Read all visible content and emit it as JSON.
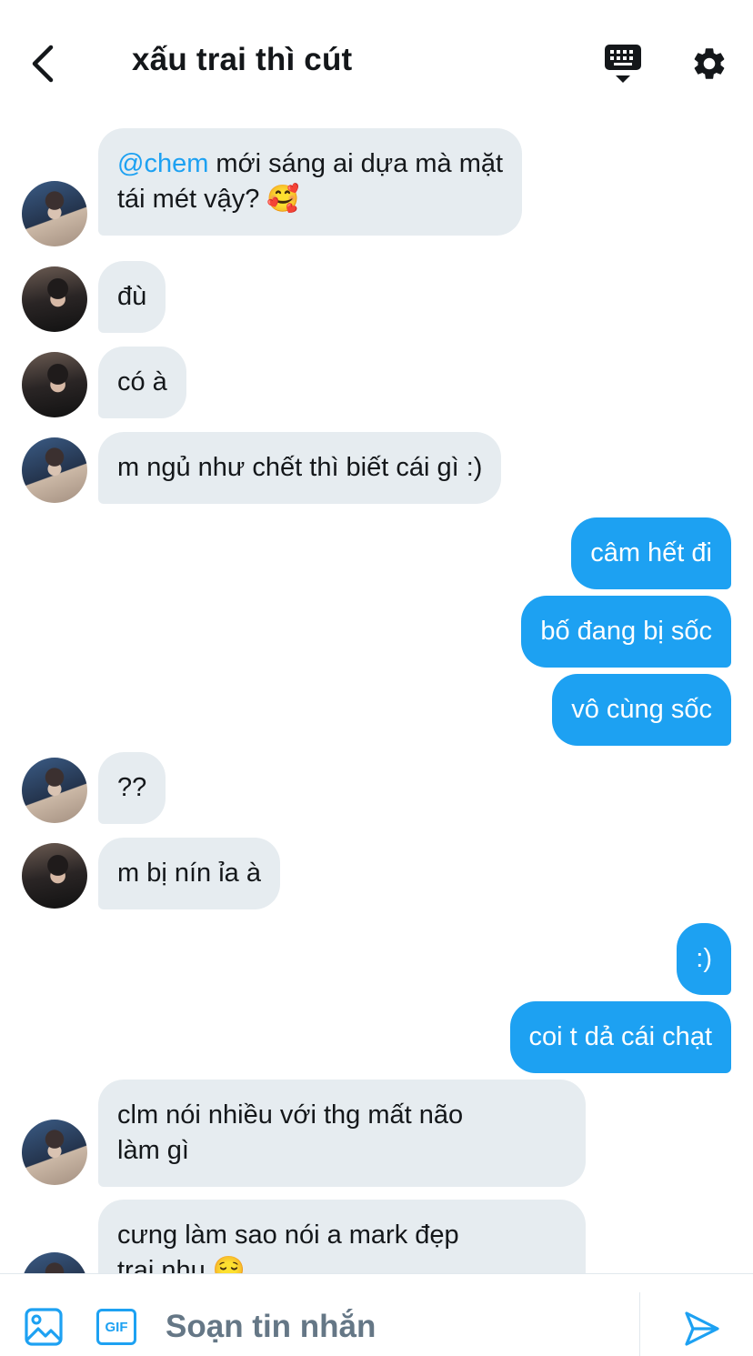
{
  "header": {
    "title": "xấu trai thì cút"
  },
  "messages": [
    {
      "dir": "in",
      "avatar": "a1",
      "lines": [
        [
          {
            "t": "@chem",
            "mention": true
          },
          {
            "t": " mới sáng ai dựa mà mặt"
          }
        ],
        [
          {
            "t": "tái mét vậy? 🥰"
          }
        ]
      ]
    },
    {
      "dir": "in",
      "avatar": "a2",
      "lines": [
        [
          {
            "t": "đù"
          }
        ]
      ]
    },
    {
      "dir": "in",
      "avatar": "a2",
      "lines": [
        [
          {
            "t": "có à"
          }
        ]
      ]
    },
    {
      "dir": "in",
      "avatar": "a1",
      "lines": [
        [
          {
            "t": "m ngủ như chết thì biết cái gì :)"
          }
        ]
      ]
    },
    {
      "dir": "out",
      "lines": [
        [
          {
            "t": "câm hết đi"
          }
        ]
      ]
    },
    {
      "dir": "out",
      "lines": [
        [
          {
            "t": "bố đang bị sốc"
          }
        ]
      ]
    },
    {
      "dir": "out",
      "lines": [
        [
          {
            "t": "vô cùng sốc"
          }
        ]
      ]
    },
    {
      "dir": "in",
      "avatar": "a1",
      "lines": [
        [
          {
            "t": "??"
          }
        ]
      ]
    },
    {
      "dir": "in",
      "avatar": "a2",
      "lines": [
        [
          {
            "t": "m bị nín ỉa à"
          }
        ]
      ]
    },
    {
      "dir": "out",
      "lines": [
        [
          {
            "t": ":)"
          }
        ]
      ]
    },
    {
      "dir": "out",
      "lines": [
        [
          {
            "t": "coi t dả cái chạt"
          }
        ]
      ]
    },
    {
      "dir": "in",
      "avatar": "a1",
      "lines": [
        [
          {
            "t": "clm nói nhiều với thg mất não"
          }
        ],
        [
          {
            "t": "làm gì"
          }
        ]
      ]
    },
    {
      "dir": "in",
      "avatar": "a1",
      "lines": [
        [
          {
            "t": "cưng làm sao nói a mark đẹp"
          }
        ],
        [
          {
            "t": "trai nhu 😌"
          }
        ]
      ]
    }
  ],
  "composer": {
    "placeholder": "Soạn tin nhắn",
    "gif_label": "GIF"
  },
  "colors": {
    "accent": "#1da1f2",
    "incoming_bg": "#e6ecf0",
    "text": "#14171a",
    "muted": "#657786"
  }
}
